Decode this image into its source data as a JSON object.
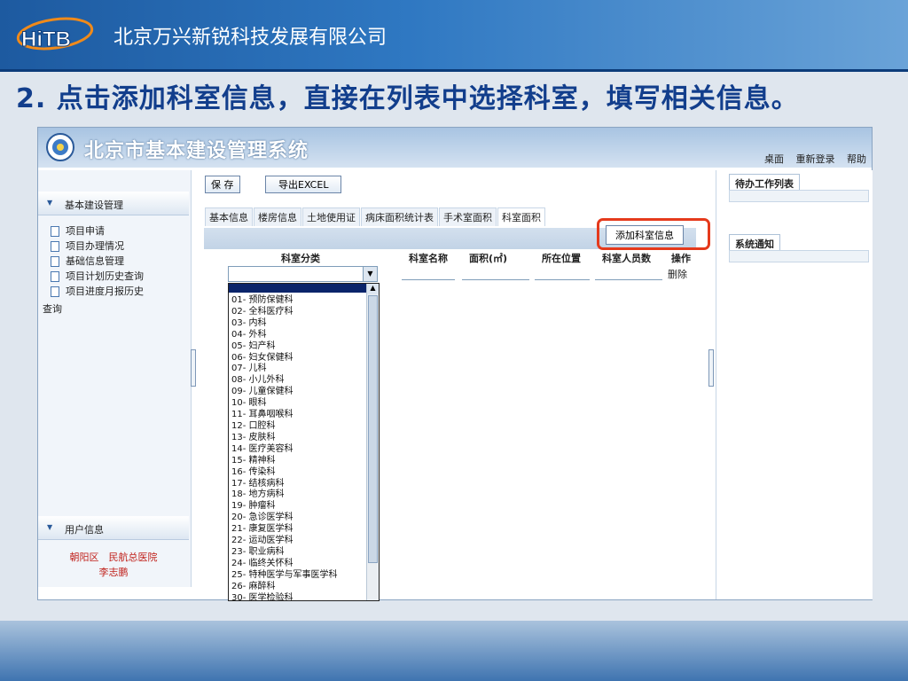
{
  "slide": {
    "company_name": "北京万兴新锐科技发展有限公司",
    "logo_text": "HiTB",
    "title": "2. 点击添加科室信息，直接在列表中选择科室，填写相关信息。"
  },
  "app": {
    "title": "北京市基本建设管理系统",
    "top_links": [
      "桌面",
      "重新登录",
      "帮助"
    ]
  },
  "left": {
    "section1": "基本建设管理",
    "menu": [
      "项目申请",
      "项目办理情况",
      "基础信息管理",
      "项目计划历史查询",
      "项目进度月报历史"
    ],
    "overflow_text": "查询",
    "section2": "用户信息",
    "user_org": "朝阳区　民航总医院",
    "user_name": "李志鹏"
  },
  "toolbar": {
    "save": "保 存",
    "export": "导出EXCEL"
  },
  "tabs": [
    "基本信息",
    "楼房信息",
    "土地使用证",
    "病床面积统计表",
    "手术室面积",
    "科室面积"
  ],
  "active_tab": 5,
  "add_button": "添加科室信息",
  "table": {
    "headers": [
      "科室分类",
      "科室名称",
      "面积(㎡)",
      "所在位置",
      "科室人员数",
      "操作"
    ],
    "delete_label": "删除"
  },
  "dropdown_options": [
    "01- 预防保健科",
    "02- 全科医疗科",
    "03- 内科",
    "04- 外科",
    "05- 妇产科",
    "06- 妇女保健科",
    "07- 儿科",
    "08- 小儿外科",
    "09- 儿童保健科",
    "10- 眼科",
    "11- 耳鼻咽喉科",
    "12- 口腔科",
    "13- 皮肤科",
    "14- 医疗美容科",
    "15- 精神科",
    "16- 传染科",
    "17- 结核病科",
    "18- 地方病科",
    "19- 肿瘤科",
    "20- 急诊医学科",
    "21- 康复医学科",
    "22- 运动医学科",
    "23- 职业病科",
    "24- 临终关怀科",
    "25- 特种医学与军事医学科",
    "26- 麻醉科",
    "30- 医学检验科"
  ],
  "right": {
    "tab1": "待办工作列表",
    "tab2": "系统通知"
  },
  "colors": {
    "highlight": "#e53a1c",
    "header_blue": "#1d5aa0"
  }
}
